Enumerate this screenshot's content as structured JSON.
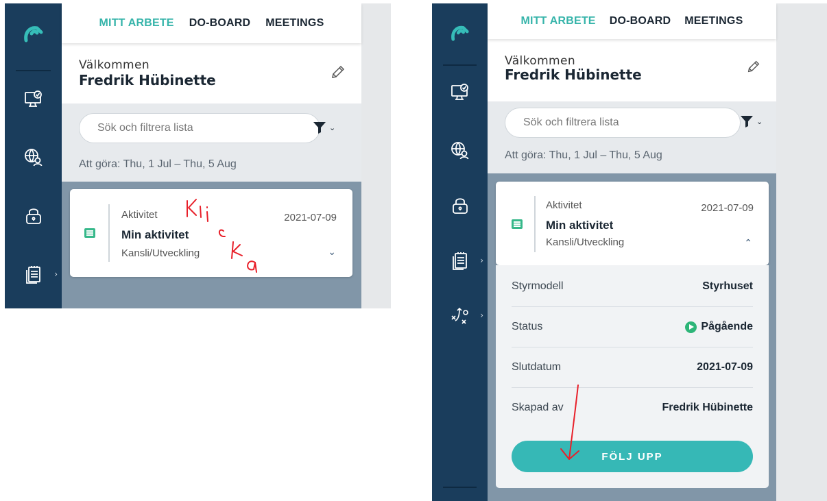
{
  "nav": {
    "tabs": [
      {
        "label": "MITT ARBETE",
        "active": true
      },
      {
        "label": "DO-BOARD",
        "active": false
      },
      {
        "label": "MEETINGS",
        "active": false
      }
    ]
  },
  "sidebar": {
    "logo_icon": "app-logo",
    "items": [
      {
        "icon": "monitor-check-icon"
      },
      {
        "icon": "globe-user-icon"
      },
      {
        "icon": "lock-icon"
      },
      {
        "icon": "clipboard-list-icon",
        "has_submenu": true
      },
      {
        "icon": "strategy-play-icon",
        "has_submenu": true
      }
    ]
  },
  "welcome": {
    "greeting": "Välkommen",
    "name": "Fredrik Hübinette",
    "edit_icon": "pencil-icon"
  },
  "search": {
    "placeholder": "Sök och filtrera lista",
    "filter_icon": "filter-icon"
  },
  "date_range": "Att göra: Thu, 1 Jul – Thu, 5 Aug",
  "item": {
    "type": "Aktivitet",
    "title": "Min aktivitet",
    "org": "Kansli/Utveckling",
    "date": "2021-07-09",
    "icon": "list-icon"
  },
  "details": {
    "rows": [
      {
        "label": "Styrmodell",
        "value": "Styrhuset"
      },
      {
        "label": "Status",
        "value": "Pågående"
      },
      {
        "label": "Slutdatum",
        "value": "2021-07-09"
      },
      {
        "label": "Skapad av",
        "value": "Fredrik Hübinette"
      }
    ],
    "status_color": "#2db578",
    "follow_up_label": "FÖLJ UPP"
  },
  "annotation": {
    "handwritten_text": "Klicka",
    "color": "#e8202a"
  },
  "colors": {
    "sidebar": "#1a3d5c",
    "accent": "#36b4aa",
    "list_background": "#8196a8"
  }
}
